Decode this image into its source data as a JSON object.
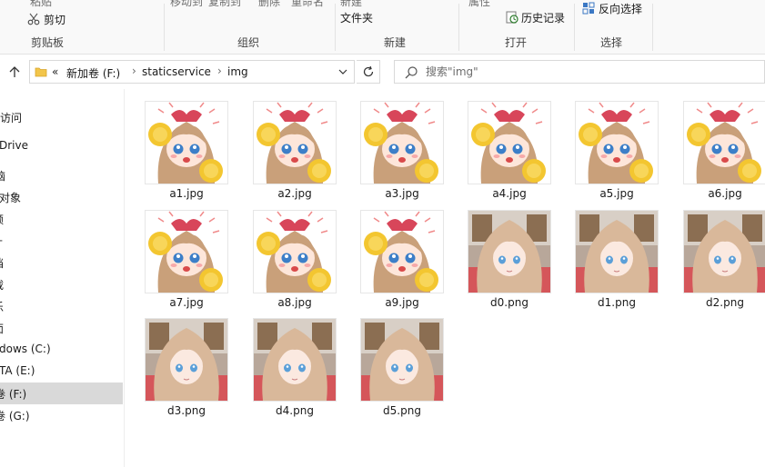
{
  "ribbon": {
    "clipboard": {
      "paste": "粘贴",
      "cut": "剪切",
      "label": "剪贴板"
    },
    "organize": {
      "move_to": "移动到",
      "copy_to": "复制到",
      "delete": "删除",
      "rename": "重命名",
      "label": "组织"
    },
    "new": {
      "new_item": "新建",
      "new_folder": "文件夹",
      "label": "新建"
    },
    "open": {
      "properties": "属性",
      "history": "历史记录",
      "label": "打开"
    },
    "select": {
      "invert": "反向选择",
      "label": "选择"
    }
  },
  "address": {
    "overflow": "«",
    "crumbs": [
      "新加卷 (F:)",
      "staticservice",
      "img"
    ],
    "sep": "›"
  },
  "search": {
    "placeholder": "搜索\"img\""
  },
  "sidebar": {
    "items": [
      {
        "label": "访问"
      },
      {
        "label": "Drive"
      },
      {
        "label": "脑"
      },
      {
        "label": "对象"
      },
      {
        "label": "频"
      },
      {
        "label": "十"
      },
      {
        "label": "档"
      },
      {
        "label": "载"
      },
      {
        "label": "乐"
      },
      {
        "label": "面"
      },
      {
        "label": "dows (C:)"
      },
      {
        "label": "TA (E:)"
      },
      {
        "label": "卷 (F:)",
        "selected": true
      },
      {
        "label": "卷 (G:)"
      }
    ]
  },
  "files": [
    {
      "name": "a1.jpg",
      "kind": "chibi"
    },
    {
      "name": "a2.jpg",
      "kind": "chibi"
    },
    {
      "name": "a3.jpg",
      "kind": "chibi"
    },
    {
      "name": "a4.jpg",
      "kind": "chibi"
    },
    {
      "name": "a5.jpg",
      "kind": "chibi"
    },
    {
      "name": "a6.jpg",
      "kind": "chibi"
    },
    {
      "name": "a7.jpg",
      "kind": "chibi"
    },
    {
      "name": "a8.jpg",
      "kind": "chibi"
    },
    {
      "name": "a9.jpg",
      "kind": "chibi"
    },
    {
      "name": "d0.png",
      "kind": "portrait"
    },
    {
      "name": "d1.png",
      "kind": "portrait"
    },
    {
      "name": "d2.png",
      "kind": "portrait"
    },
    {
      "name": "d3.png",
      "kind": "portrait"
    },
    {
      "name": "d4.png",
      "kind": "portrait"
    },
    {
      "name": "d5.png",
      "kind": "portrait"
    }
  ],
  "colors": {
    "selected_bg": "#d9d9d9",
    "folder_yellow": "#f2c54a",
    "ribbon_bg": "#f9f9f9"
  }
}
